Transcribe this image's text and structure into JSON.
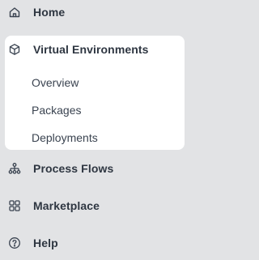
{
  "nav": {
    "home": {
      "label": "Home",
      "icon": "home-icon"
    },
    "virtual_environments": {
      "label": "Virtual Environments",
      "icon": "cube-icon",
      "expanded": true,
      "children": [
        {
          "label": "Overview"
        },
        {
          "label": "Packages"
        },
        {
          "label": "Deployments"
        }
      ]
    },
    "process_flows": {
      "label": "Process Flows",
      "icon": "flow-icon"
    },
    "marketplace": {
      "label": "Marketplace",
      "icon": "grid-icon"
    },
    "help": {
      "label": "Help",
      "icon": "help-icon"
    }
  },
  "colors": {
    "background": "#e2e3e5",
    "card": "#ffffff",
    "text": "#2e3641"
  }
}
